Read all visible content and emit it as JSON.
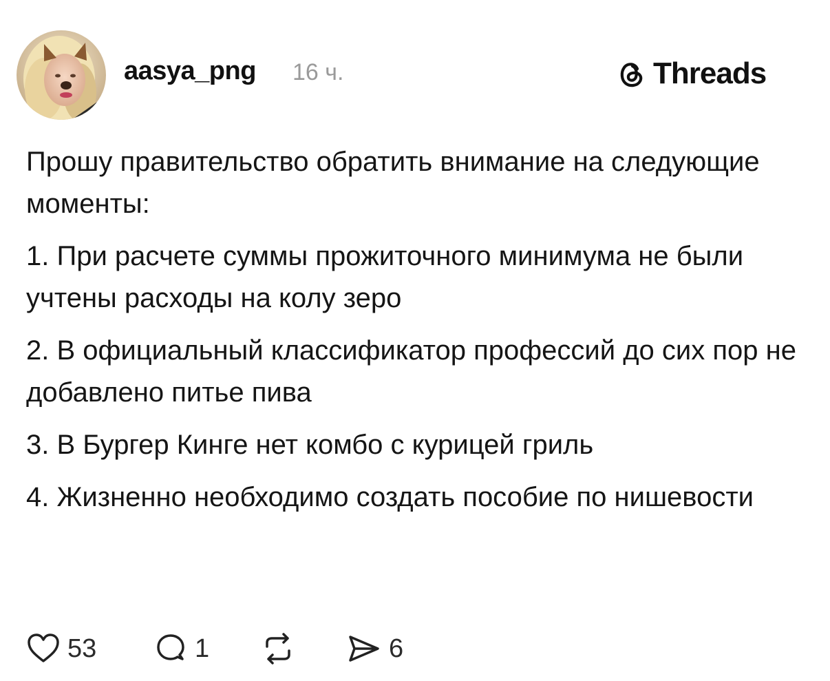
{
  "post": {
    "author": {
      "username": "aasya_png",
      "time_ago": "16 ч.",
      "avatar_icon": "avatar-photo"
    },
    "brand": {
      "name": "Threads",
      "icon": "threads-logo-icon"
    },
    "paragraphs": [
      "Прошу правительство обратить внимание на следующие моменты:",
      "1. При расчете суммы прожиточного минимума не были учтены расходы на колу зеро",
      "2. В официальный классификатор профессий до сих пор не добавлено питье пива",
      "3. В Бургер Кинге нет комбо с курицей гриль",
      "4. Жизненно необходимо создать пособие по нишевости"
    ],
    "actions": {
      "likes": "53",
      "replies": "1",
      "reposts": "",
      "shares": "6"
    }
  }
}
